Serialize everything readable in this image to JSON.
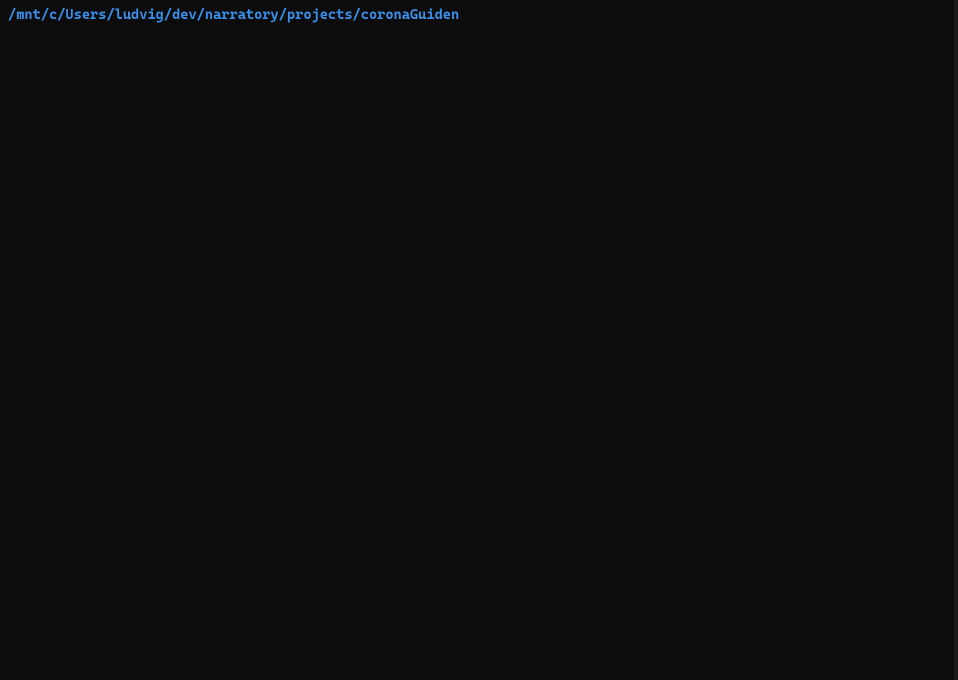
{
  "terminal": {
    "current_path": "/mnt/c/Users/ludvig/dev/narratory/projects/coronaGuiden",
    "colors": {
      "background": "#0c0c0c",
      "path_text": "#3b8eea"
    }
  }
}
